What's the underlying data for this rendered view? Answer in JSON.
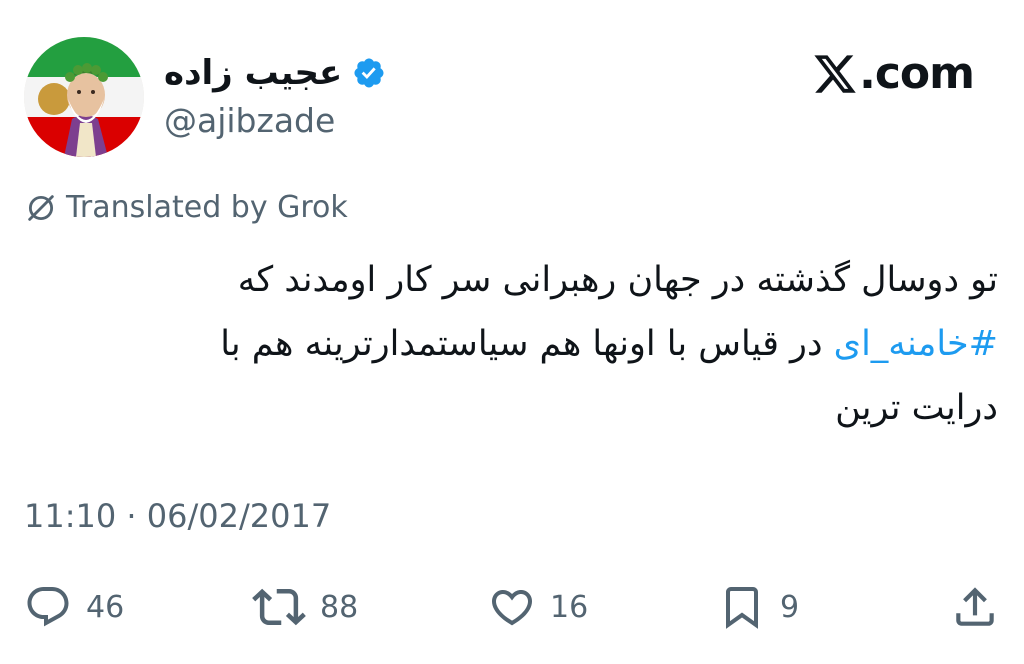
{
  "author": {
    "display_name": "عجیب زاده",
    "handle": "@ajibzade",
    "verified": true,
    "avatar": "avatar-illustration"
  },
  "brand": {
    "label": ".com",
    "icon": "x-logo-icon"
  },
  "translation": {
    "label": "Translated by Grok",
    "icon": "translate-off-icon"
  },
  "tweet": {
    "line1": "تو دوسال گذشته در جهان رهبرانی سر کار اومدند که",
    "hashtag": "#خامنه_ای",
    "line2_rest": " در قیاس با اونها هم سیاستمدارترینه هم با",
    "line3": "درایت ترین"
  },
  "timestamp": "11:10 · 06/02/2017",
  "actions": {
    "replies": {
      "icon": "reply-icon",
      "count": "46"
    },
    "reposts": {
      "icon": "repost-icon",
      "count": "88"
    },
    "likes": {
      "icon": "like-icon",
      "count": "16"
    },
    "bookmarks": {
      "icon": "bookmark-icon",
      "count": "9"
    },
    "share": {
      "icon": "share-icon"
    }
  },
  "colors": {
    "text": "#0f1419",
    "secondary": "#536471",
    "accent": "#1d9bf0"
  }
}
